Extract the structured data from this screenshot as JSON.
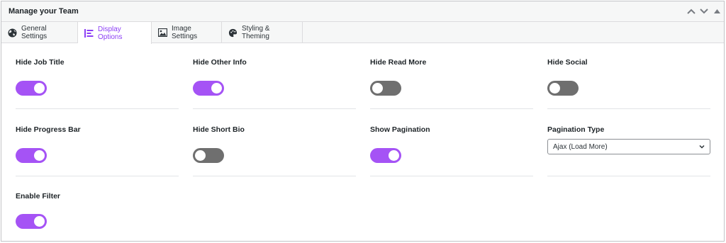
{
  "panel": {
    "title": "Manage your Team",
    "controls": [
      "chevron-up-icon",
      "chevron-down-icon",
      "triangle-up-icon"
    ]
  },
  "tabs": [
    {
      "label": "General Settings",
      "icon": "globe-icon",
      "active": false
    },
    {
      "label": "Display Options",
      "icon": "display-options-icon",
      "active": true
    },
    {
      "label": "Image Settings",
      "icon": "image-icon",
      "active": false
    },
    {
      "label": "Styling & Theming",
      "icon": "palette-icon",
      "active": false
    }
  ],
  "options": {
    "hide_job_title": {
      "label": "Hide Job Title",
      "enabled": true
    },
    "hide_other_info": {
      "label": "Hide Other Info",
      "enabled": true
    },
    "hide_read_more": {
      "label": "Hide Read More",
      "enabled": false
    },
    "hide_social": {
      "label": "Hide Social",
      "enabled": false
    },
    "hide_progress_bar": {
      "label": "Hide Progress Bar",
      "enabled": true
    },
    "hide_short_bio": {
      "label": "Hide Short Bio",
      "enabled": false
    },
    "show_pagination": {
      "label": "Show Pagination",
      "enabled": true
    },
    "pagination_type": {
      "label": "Pagination Type",
      "value": "Ajax (Load More)"
    },
    "enable_filter": {
      "label": "Enable Filter",
      "enabled": true
    }
  },
  "colors": {
    "accent": "#a553f5",
    "active_tab_text": "#8c3ff5",
    "toggle_off": "#6f6f6f"
  }
}
